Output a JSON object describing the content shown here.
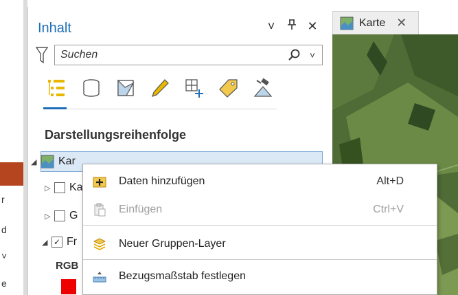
{
  "left_strip": {
    "fragments": [
      "r",
      "d",
      "˅",
      "e"
    ]
  },
  "pane": {
    "title": "Inhalt",
    "controls": {
      "menu": "˅",
      "pin": "И",
      "close": "✕"
    },
    "search": {
      "placeholder": "Suchen"
    },
    "toolbar_icons": [
      "drawing-order-icon",
      "database-icon",
      "source-icon",
      "edit-icon",
      "snapping-icon",
      "label-icon",
      "perspective-imagery-icon"
    ],
    "section_title": "Darstellungsreihenfolge",
    "tree": [
      {
        "label": "Kar",
        "expanded": true,
        "checkbox": false
      },
      {
        "label": "Ka",
        "expanded": false,
        "checkbox": true,
        "checked": false
      },
      {
        "label": "G",
        "expanded": false,
        "checkbox": true,
        "checked": false
      },
      {
        "label": "Fr",
        "expanded": true,
        "checkbox": true,
        "checked": true
      }
    ],
    "rgb_label": "RGB"
  },
  "tab": {
    "label": "Karte",
    "close": "✕"
  },
  "context_menu": {
    "items": [
      {
        "label": "Daten hinzufügen",
        "shortcut": "Alt+D",
        "icon": "add-data-icon",
        "enabled": true
      },
      {
        "label": "Einfügen",
        "shortcut": "Ctrl+V",
        "icon": "paste-icon",
        "enabled": false
      },
      {
        "label": "Neuer Gruppen-Layer",
        "shortcut": "",
        "icon": "group-layer-icon",
        "enabled": true
      },
      {
        "label": "Bezugsmaßstab festlegen",
        "shortcut": "",
        "icon": "reference-scale-icon",
        "enabled": true
      }
    ]
  },
  "colors": {
    "accent": "#1d6fb8",
    "selection": "#dbe8f6",
    "swatch": "#ee0000"
  }
}
